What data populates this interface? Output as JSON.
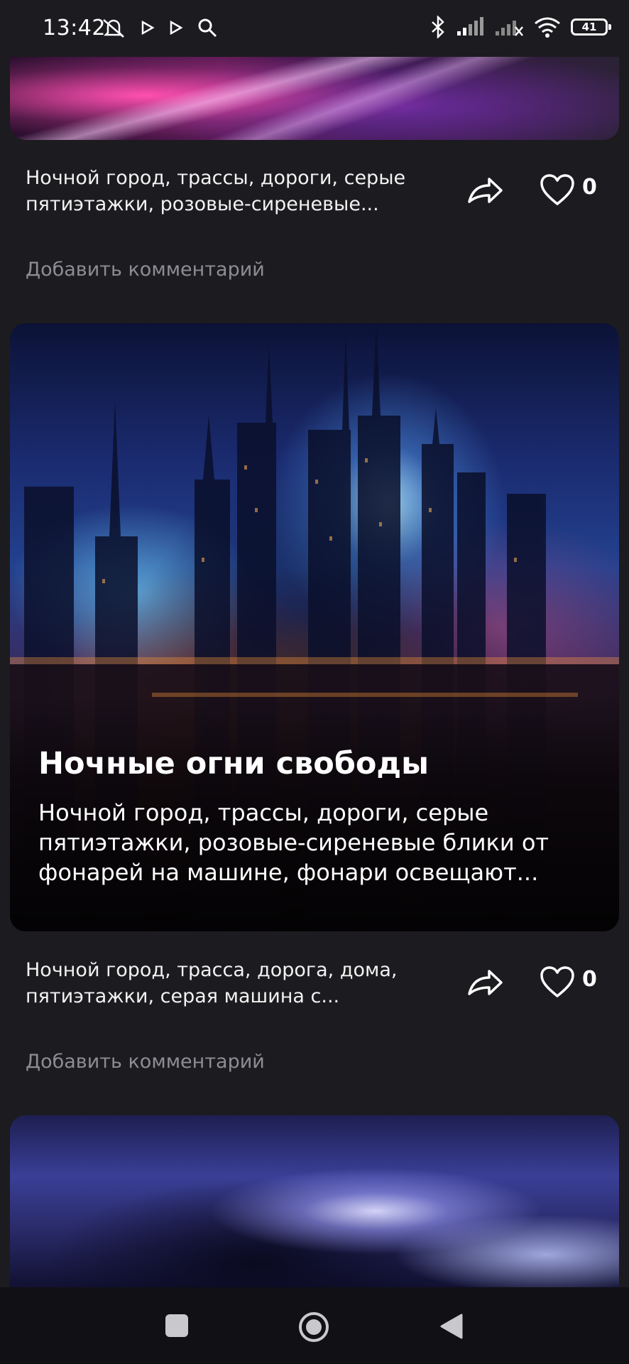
{
  "status_bar": {
    "time": "13:42",
    "battery": "41",
    "icons": [
      "bell-off-icon",
      "play-icon",
      "play-icon",
      "search-icon",
      "bluetooth-icon",
      "signal-icon",
      "signal-off-icon",
      "wifi-icon",
      "battery-icon"
    ]
  },
  "posts": [
    {
      "description": "Ночной город, трассы, дороги, серые пятиэтажки, розовые-сиреневые...",
      "likes": "0",
      "comment_placeholder": "Добавить комментарий"
    },
    {
      "image_title": "Ночные огни свободы",
      "image_text": "Ночной город, трассы, дороги, серые пятиэтажки, розовые-сиреневые блики от фонарей на машине, фонари освещают...",
      "description": "Ночной город, трасса, дорога, дома, пятиэтажки, серая машина с...",
      "likes": "0",
      "comment_placeholder": "Добавить комментарий"
    }
  ],
  "nav_bar": {
    "icons": [
      "recents-icon",
      "home-icon",
      "back-icon"
    ]
  },
  "colors": {
    "background": "#1c1b1f",
    "muted_text": "#8e8d93",
    "nav_background": "#111014"
  }
}
